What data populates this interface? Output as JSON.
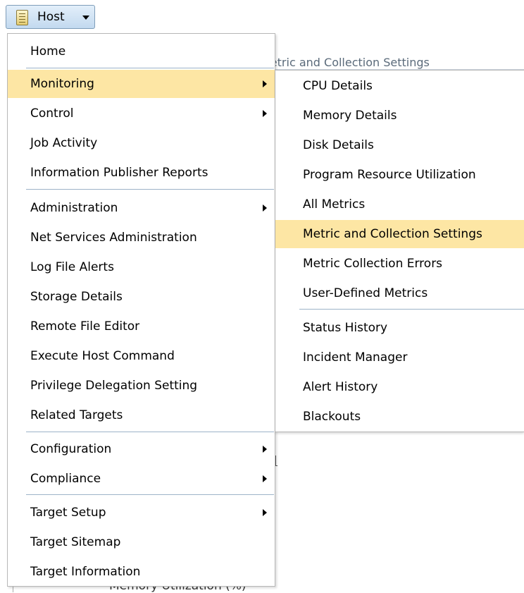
{
  "background": {
    "section_heading": "Metric and Collection Settings",
    "footer_text": "Memory Utilization (%)"
  },
  "host_button": {
    "label": "Host",
    "icon": "host-server-icon",
    "caret_icon": "caret-down-icon"
  },
  "menu": {
    "items": [
      {
        "label": "Home"
      },
      {
        "label": "Monitoring",
        "submenu": true,
        "highlighted": true
      },
      {
        "label": "Control",
        "submenu": true
      },
      {
        "label": "Job Activity"
      },
      {
        "label": "Information Publisher Reports"
      },
      {
        "label": "Administration",
        "submenu": true
      },
      {
        "label": "Net Services Administration"
      },
      {
        "label": "Log File Alerts"
      },
      {
        "label": "Storage Details"
      },
      {
        "label": "Remote File Editor"
      },
      {
        "label": "Execute Host Command"
      },
      {
        "label": "Privilege Delegation Setting"
      },
      {
        "label": "Related Targets"
      },
      {
        "label": "Configuration",
        "submenu": true
      },
      {
        "label": "Compliance",
        "submenu": true
      },
      {
        "label": "Target Setup",
        "submenu": true
      },
      {
        "label": "Target Sitemap"
      },
      {
        "label": "Target Information"
      }
    ]
  },
  "monitoring_submenu": {
    "items": [
      {
        "label": "CPU Details"
      },
      {
        "label": "Memory Details"
      },
      {
        "label": "Disk Details"
      },
      {
        "label": "Program Resource Utilization"
      },
      {
        "label": "All Metrics"
      },
      {
        "label": "Metric and Collection Settings",
        "highlighted": true
      },
      {
        "label": "Metric Collection Errors"
      },
      {
        "label": "User-Defined Metrics"
      },
      {
        "label": "Status History"
      },
      {
        "label": "Incident Manager"
      },
      {
        "label": "Alert History"
      },
      {
        "label": "Blackouts"
      }
    ]
  },
  "colors": {
    "highlight": "#fde6a4",
    "separator": "#9db3c8",
    "button_gradient_top": "#e3effa",
    "button_gradient_bottom": "#c2d9ef"
  }
}
